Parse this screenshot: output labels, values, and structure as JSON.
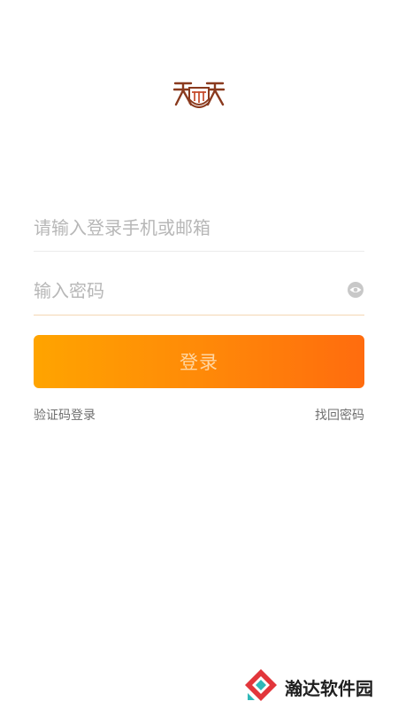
{
  "login": {
    "account_placeholder": "请输入登录手机或邮箱",
    "password_placeholder": "输入密码",
    "login_button_label": "登录",
    "verification_code_login_label": "验证码登录",
    "forgot_password_label": "找回密码"
  },
  "watermark": {
    "text": "瀚达软件园"
  },
  "icons": {
    "logo": "app-logo",
    "password_visibility": "eye-icon"
  },
  "colors": {
    "button_gradient_start": "#ffa400",
    "button_gradient_end": "#ff6c0e",
    "button_text": "#ffd6a2",
    "placeholder": "#b7b7b7",
    "logo_brown": "#8a3a1e"
  }
}
